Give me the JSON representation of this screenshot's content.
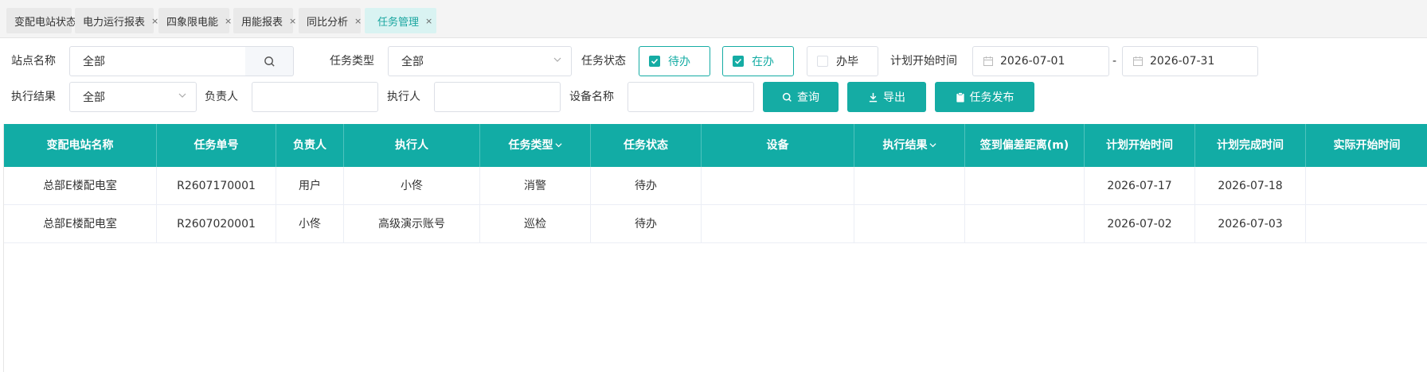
{
  "tabs": [
    {
      "label": "变配电站状态",
      "closable": false,
      "active": false
    },
    {
      "label": "电力运行报表",
      "closable": true,
      "active": false
    },
    {
      "label": "四象限电能",
      "closable": true,
      "active": false
    },
    {
      "label": "用能报表",
      "closable": true,
      "active": false
    },
    {
      "label": "同比分析",
      "closable": true,
      "active": false
    },
    {
      "label": "任务管理",
      "closable": true,
      "active": true
    }
  ],
  "tab_close_glyph": "×",
  "filters": {
    "station_label": "站点名称",
    "station_value": "全部",
    "task_type_label": "任务类型",
    "task_type_value": "全部",
    "task_status_label": "任务状态",
    "status_options": [
      {
        "label": "待办",
        "checked": true
      },
      {
        "label": "在办",
        "checked": true
      },
      {
        "label": "办毕",
        "checked": false
      }
    ],
    "plan_start_label": "计划开始时间",
    "date_from": "2026-07-01",
    "date_sep": "-",
    "date_to": "2026-07-31",
    "exec_result_label": "执行结果",
    "exec_result_value": "全部",
    "owner_label": "负责人",
    "owner_value": "",
    "executor_label": "执行人",
    "executor_value": "",
    "device_label": "设备名称",
    "device_value": ""
  },
  "buttons": {
    "query": "查询",
    "export": "导出",
    "publish": "任务发布"
  },
  "table": {
    "columns": [
      "变配电站名称",
      "任务单号",
      "负责人",
      "执行人",
      "任务类型",
      "任务状态",
      "设备",
      "执行结果",
      "签到偏差距离(m)",
      "计划开始时间",
      "计划完成时间",
      "实际开始时间"
    ],
    "sortable_columns": [
      "任务类型",
      "执行结果"
    ],
    "rows": [
      [
        "总部E楼配电室",
        "R2607170001",
        "用户",
        "小佟",
        "消警",
        "待办",
        "",
        "",
        "",
        "2026-07-17",
        "2026-07-18",
        ""
      ],
      [
        "总部E楼配电室",
        "R2607020001",
        "小佟",
        "高级演示账号",
        "巡检",
        "待办",
        "",
        "",
        "",
        "2026-07-02",
        "2026-07-03",
        ""
      ]
    ]
  },
  "colors": {
    "accent": "#15aca4",
    "header_bg": "#12aca5",
    "active_tab_bg": "#d9f3f2"
  },
  "icons": {
    "search": "search-icon",
    "chevron": "chevron-down-icon",
    "calendar": "calendar-icon",
    "check": "check-icon",
    "download": "download-icon",
    "clipboard": "clipboard-icon"
  }
}
